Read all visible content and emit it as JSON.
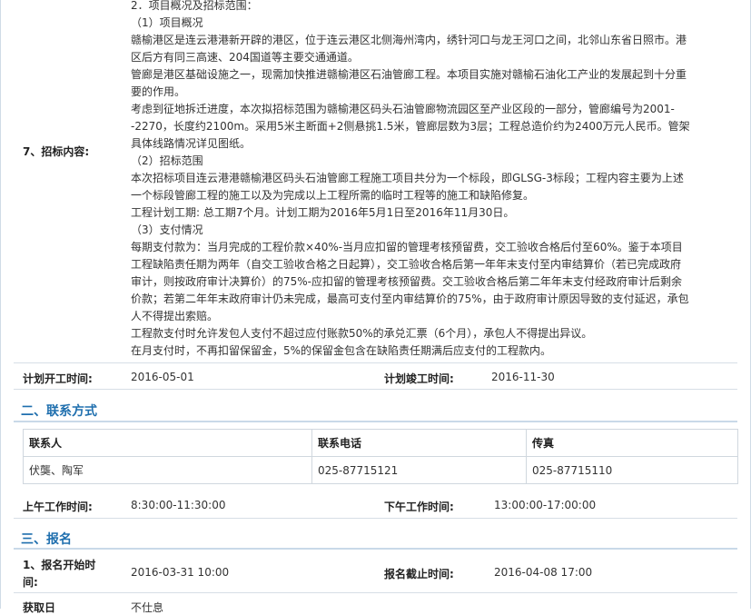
{
  "bidding_content": {
    "label": "7、招标内容:",
    "lines": [
      "2．项目概况及招标范围：",
      "（1）项目概况",
      "赣榆港区是连云港港新开辟的港区，位于连云港区北侧海州湾内，绣针河口与龙王河口之间，北邻山东省日照市。港",
      "区后方有同三高速、204国道等主要交通通道。",
      "管廊是港区基础设施之一，现需加快推进赣榆港区石油管廊工程。本项目实施对赣榆石油化工产业的发展起到十分重",
      "要的作用。",
      "考虑到征地拆迁进度，本次拟招标范围为赣榆港区码头石油管廊物流园区至产业区段的一部分，管廊编号为2001-",
      "-2270，长度约2100m。采用5米主断面+2侧悬挑1.5米，管廊层数为3层；工程总造价约为2400万元人民币。管架",
      "具体线路情况详见图纸。",
      "（2）招标范围",
      "本次招标项目连云港港赣榆港区码头石油管廊工程施工项目共分为一个标段，即GLSG-3标段；工程内容主要为上述",
      "一个标段管廊工程的施工以及为完成以上工程所需的临时工程等的施工和缺陷修复。",
      "工程计划工期: 总工期7个月。计划工期为2016年5月1日至2016年11月30日。",
      "（3）支付情况",
      "每期支付款为：当月完成的工程价款×40%-当月应扣留的管理考核预留费，交工验收合格后付至60%。鉴于本项目",
      "工程缺陷责任期为两年（自交工验收合格之日起算），交工验收合格后第一年年末支付至内审结算价（若已完成政府",
      "审计，则按政府审计决算价）的75%-应扣留的管理考核预留费。交工验收合格后第二年年末支付经政府审计后剩余",
      "价款；若第二年年末政府审计仍未完成，最高可支付至内审结算价的75%，由于政府审计原因导致的支付延迟，承包",
      "人不得提出索赔。",
      "工程款支付时允许发包人支付不超过应付账款50%的承兑汇票（6个月），承包人不得提出异议。",
      "在月支付时，不再扣留保留金，5%的保留金包含在缺陷责任期满后应支付的工程款内。"
    ]
  },
  "schedule": {
    "start_label": "计划开工时间:",
    "start_value": "2016-05-01",
    "end_label": "计划竣工时间:",
    "end_value": "2016-11-30"
  },
  "contact_section": {
    "title": "二、联系方式",
    "headers": [
      "联系人",
      "联系电话",
      "传真"
    ],
    "row": [
      "伏龑、陶军",
      "025-87715121",
      "025-87715110"
    ],
    "am_label": "上午工作时间:",
    "am_value": "8:30:00-11:30:00",
    "pm_label": "下午工作时间:",
    "pm_value": "13:00:00-17:00:00"
  },
  "registration_section": {
    "title": "三、报名",
    "start_label_1": "1、报名开始时",
    "start_label_2": "间:",
    "start_value": "2016-03-31 10:00",
    "end_label": "报名截止时间:",
    "end_value": "2016-04-08 17:00",
    "partial_label": "获取日",
    "partial_value": "不仕息"
  }
}
